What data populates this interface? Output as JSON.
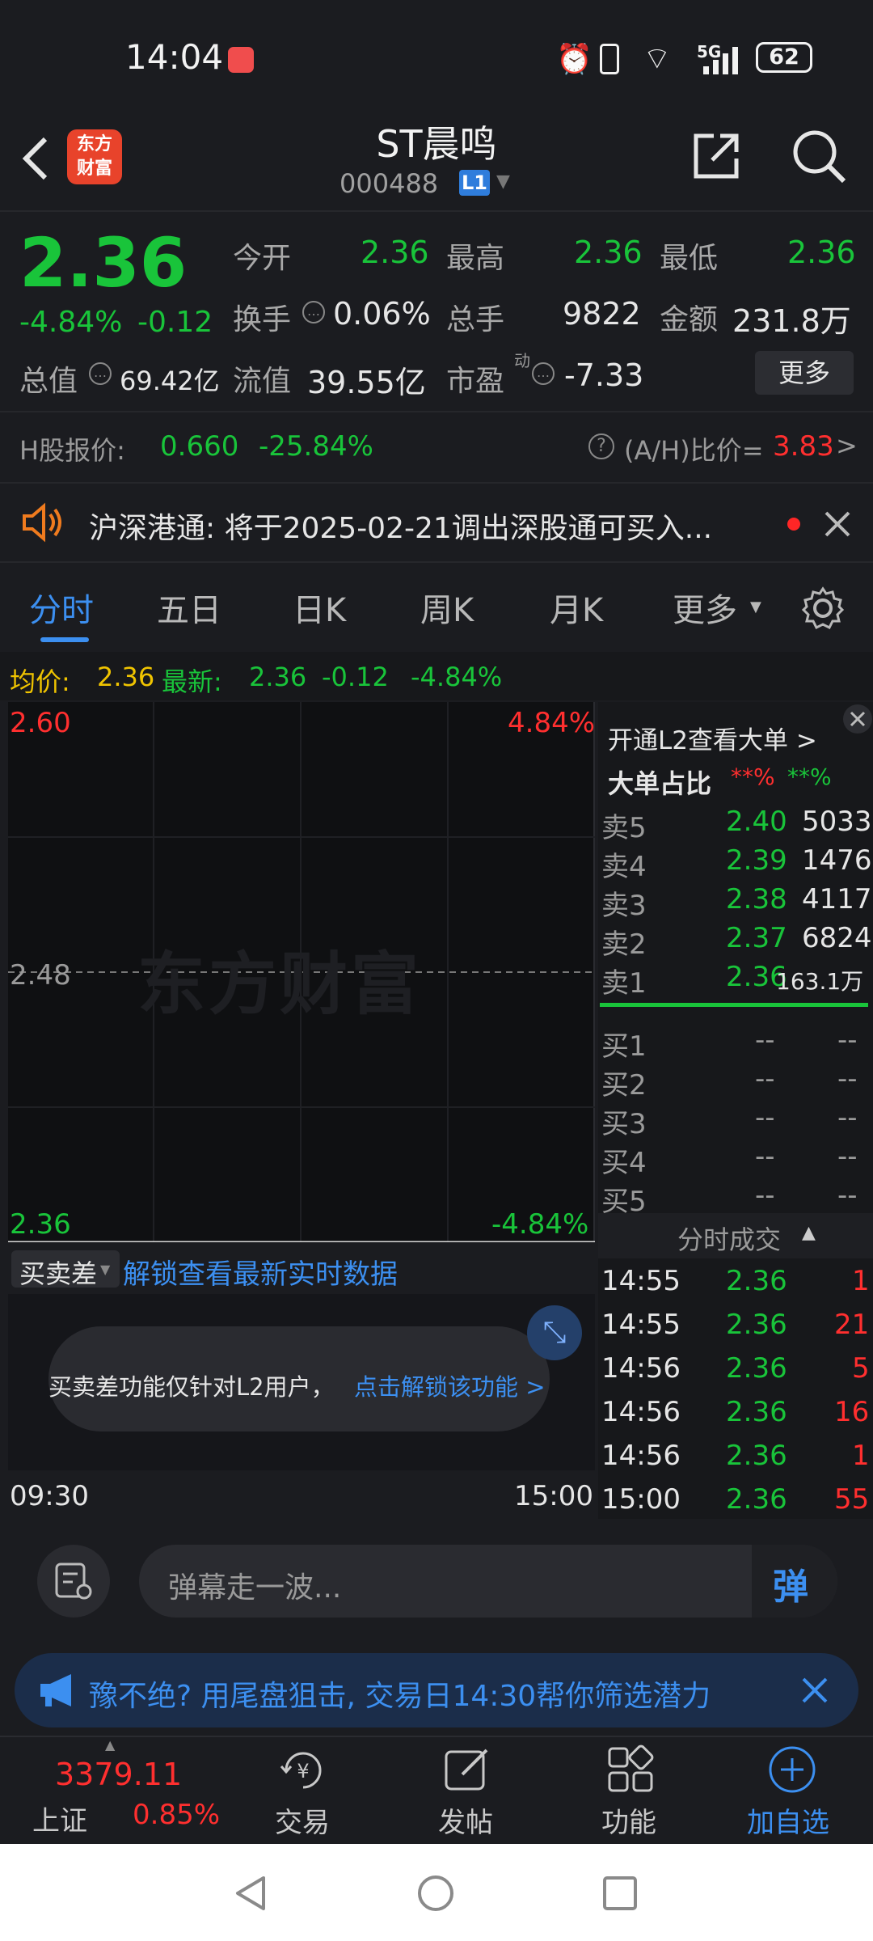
{
  "status": {
    "time": "14:04",
    "battery": "62",
    "network": "5G"
  },
  "header": {
    "name": "ST晨鸣",
    "code": "000488",
    "level_badge": "L1",
    "logo_text": "东方\n财富"
  },
  "quote": {
    "price": "2.36",
    "change_pct": "-4.84%",
    "change": "-0.12",
    "open_label": "今开",
    "open": "2.36",
    "high_label": "最高",
    "high": "2.36",
    "low_label": "最低",
    "low": "2.36",
    "turnover_label": "换手",
    "turnover": "0.06%",
    "volume_label": "总手",
    "volume": "9822",
    "amount_label": "金额",
    "amount": "231.8万",
    "mcap_label": "总值",
    "mcap": "69.42亿",
    "float_label": "流值",
    "float": "39.55亿",
    "pe_label": "市盈",
    "pe_sup": "动",
    "pe": "-7.33",
    "more": "更多",
    "h_label": "H股报价:",
    "h_price": "0.660",
    "h_pct": "-25.84%",
    "ah_label": "(A/H)比价=",
    "ah_value": "3.83",
    "ah_arrow": ">"
  },
  "notice": {
    "text": "沪深港通:  将于2025-02-21调出深股通可买入..."
  },
  "tabs": [
    "分时",
    "五日",
    "日K",
    "周K",
    "月K",
    "更多"
  ],
  "avgbar": {
    "avg_label": "均价:",
    "avg": "2.36",
    "latest_label": "最新:",
    "latest": "2.36",
    "chg": "-0.12",
    "pct": "-4.84%"
  },
  "chart": {
    "y_top": "2.60",
    "y_mid": "2.48",
    "y_bot": "2.36",
    "pct_top": "4.84%",
    "pct_bot": "-4.84%",
    "watermark": "东方财富",
    "x_start": "09:30",
    "x_end": "15:00",
    "sub_selector": "买卖差",
    "unlock_link": "解锁查看最新实时数据",
    "locked_text": "买卖差功能仅针对L2用户，",
    "locked_link": "点击解锁该功能 >"
  },
  "orderbook": {
    "l2_link": "开通L2查看大单 >",
    "big_order_label": "大单占比",
    "big_red": "**%",
    "big_green": "**%",
    "asks": [
      {
        "label": "卖5",
        "price": "2.40",
        "vol": "5033"
      },
      {
        "label": "卖4",
        "price": "2.39",
        "vol": "1476"
      },
      {
        "label": "卖3",
        "price": "2.38",
        "vol": "4117"
      },
      {
        "label": "卖2",
        "price": "2.37",
        "vol": "6824"
      },
      {
        "label": "卖1",
        "price": "2.36",
        "vol": "163.1万"
      }
    ],
    "bids": [
      {
        "label": "买1",
        "price": "--",
        "vol": "--"
      },
      {
        "label": "买2",
        "price": "--",
        "vol": "--"
      },
      {
        "label": "买3",
        "price": "--",
        "vol": "--"
      },
      {
        "label": "买4",
        "price": "--",
        "vol": "--"
      },
      {
        "label": "买5",
        "price": "--",
        "vol": "--"
      }
    ],
    "ticks_label": "分时成交",
    "ticks": [
      {
        "time": "14:55",
        "price": "2.36",
        "vol": "1"
      },
      {
        "time": "14:55",
        "price": "2.36",
        "vol": "21"
      },
      {
        "time": "14:56",
        "price": "2.36",
        "vol": "5"
      },
      {
        "time": "14:56",
        "price": "2.36",
        "vol": "16"
      },
      {
        "time": "14:56",
        "price": "2.36",
        "vol": "1"
      },
      {
        "time": "15:00",
        "price": "2.36",
        "vol": "55"
      }
    ]
  },
  "input": {
    "placeholder": "弹幕走一波...",
    "send": "弹"
  },
  "ad": {
    "text": "豫不绝? 用尾盘狙击, 交易日14:30帮你筛选潜力"
  },
  "nav": {
    "index_value": "3379.11",
    "index_name": "上证",
    "index_pct": "0.85%",
    "items": [
      "交易",
      "发帖",
      "功能",
      "加自选"
    ]
  }
}
